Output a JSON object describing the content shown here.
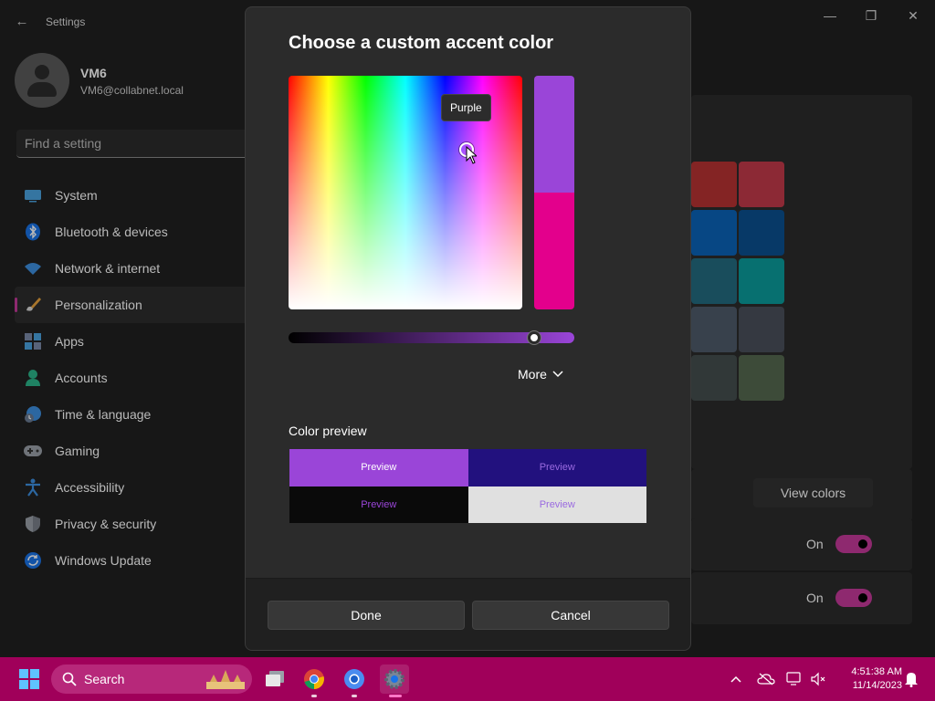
{
  "window": {
    "title": "Settings",
    "back_label": "←",
    "minimize_label": "—",
    "maximize_label": "❐",
    "close_label": "✕"
  },
  "profile": {
    "name": "VM6",
    "email": "VM6@collabnet.local"
  },
  "search": {
    "placeholder": "Find a setting"
  },
  "nav": {
    "items": [
      {
        "label": "System",
        "icon": "monitor-icon"
      },
      {
        "label": "Bluetooth & devices",
        "icon": "bluetooth-icon"
      },
      {
        "label": "Network & internet",
        "icon": "wifi-icon"
      },
      {
        "label": "Personalization",
        "icon": "paintbrush-icon",
        "active": true
      },
      {
        "label": "Apps",
        "icon": "apps-icon"
      },
      {
        "label": "Accounts",
        "icon": "person-icon"
      },
      {
        "label": "Time & language",
        "icon": "globe-clock-icon"
      },
      {
        "label": "Gaming",
        "icon": "gamepad-icon"
      },
      {
        "label": "Accessibility",
        "icon": "accessibility-icon"
      },
      {
        "label": "Privacy & security",
        "icon": "shield-icon"
      },
      {
        "label": "Windows Update",
        "icon": "update-icon"
      }
    ]
  },
  "background": {
    "view_colors_label": "View colors",
    "toggle1_state": "On",
    "toggle2_state": "On",
    "swatch_colors": [
      "#b83232",
      "#c23a4a",
      "#0a63b8",
      "#0a4f8f",
      "#236b80",
      "#0a9c9c",
      "#4e5a6a",
      "#4a4f5a",
      "#454e4e",
      "#556850"
    ]
  },
  "dialog": {
    "title": "Choose a custom accent color",
    "tooltip": "Purple",
    "more_label": "More",
    "color_preview_label": "Color preview",
    "preview_text": "Preview",
    "done_label": "Done",
    "cancel_label": "Cancel",
    "new_color": "#9a45d8",
    "current_color": "#e3008c",
    "brightness_value": 0.86
  },
  "taskbar": {
    "search_label": "Search",
    "time": "4:51:38 AM",
    "date": "11/14/2023",
    "accent": "#a0005a"
  }
}
